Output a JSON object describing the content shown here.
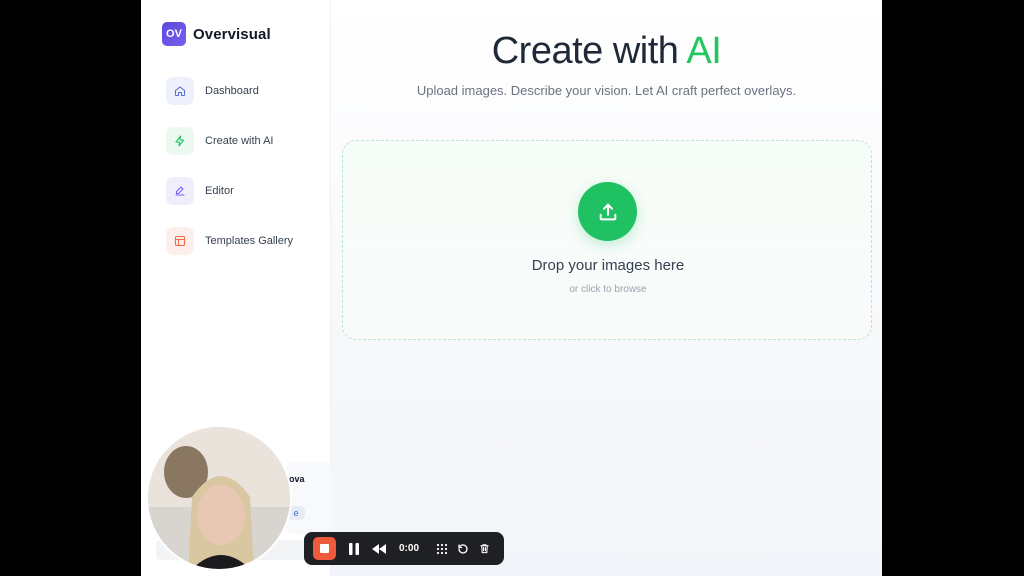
{
  "brand": {
    "logo_text": "OV",
    "name": "Overvisual"
  },
  "sidebar": {
    "items": [
      {
        "label": "Dashboard",
        "icon": "home-icon",
        "color": "#5b6fd6"
      },
      {
        "label": "Create with AI",
        "icon": "sparkle-icon",
        "color": "#22c55e"
      },
      {
        "label": "Editor",
        "icon": "pen-icon",
        "color": "#7c5cf0"
      },
      {
        "label": "Templates Gallery",
        "icon": "layout-icon",
        "color": "#f26b4c"
      }
    ],
    "profile_name_partial": "ova",
    "profile_chip_partial": "e"
  },
  "main": {
    "title_prefix": "Create with ",
    "title_accent": "AI",
    "subtitle": "Upload images. Describe your vision. Let AI craft perfect overlays.",
    "dropzone": {
      "title": "Drop your images here",
      "subtitle": "or click to browse",
      "icon": "upload-icon"
    }
  },
  "recorder": {
    "time": "0:00",
    "buttons": [
      "stop-icon",
      "pause-icon",
      "rewind-icon",
      "grid-icon",
      "restart-icon",
      "trash-icon"
    ]
  },
  "colors": {
    "accent": "#22c55e",
    "upload_button": "#1fc163",
    "record": "#ef5a3c"
  }
}
